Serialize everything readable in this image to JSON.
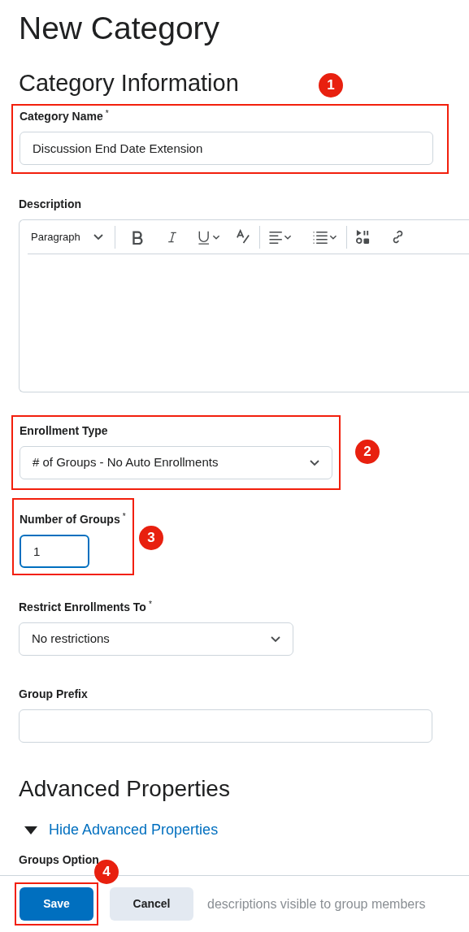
{
  "page_title": "New Category",
  "section_title": "Category Information",
  "fields": [
    {
      "kind": "text",
      "label": "Category Name",
      "required_mark": "*",
      "value": "Discussion End Date Extension",
      "badge": "1"
    },
    {
      "kind": "editor",
      "label": "Description",
      "block_format": "Paragraph"
    },
    {
      "kind": "select",
      "label": "Enrollment Type",
      "value": "# of Groups - No Auto Enrollments",
      "badge": "2"
    },
    {
      "kind": "number",
      "label": "Number of Groups",
      "required_mark": "*",
      "value": "1",
      "focused": true,
      "badge": "3"
    },
    {
      "kind": "select",
      "label": "Restrict Enrollments To",
      "required_mark": "*",
      "value": "No restrictions"
    },
    {
      "kind": "text",
      "label": "Group Prefix"
    }
  ],
  "advanced_title": "Advanced Properties",
  "advanced_toggle": {
    "label": "Hide Advanced Properties",
    "expanded": true
  },
  "groups_options": {
    "label": "Groups Option",
    "option_text": "descriptions visible to group members"
  },
  "footer": {
    "buttons": [
      {
        "label": "Save",
        "kind": "primary",
        "badge": "4"
      },
      {
        "label": "Cancel",
        "kind": "secondary"
      }
    ]
  }
}
